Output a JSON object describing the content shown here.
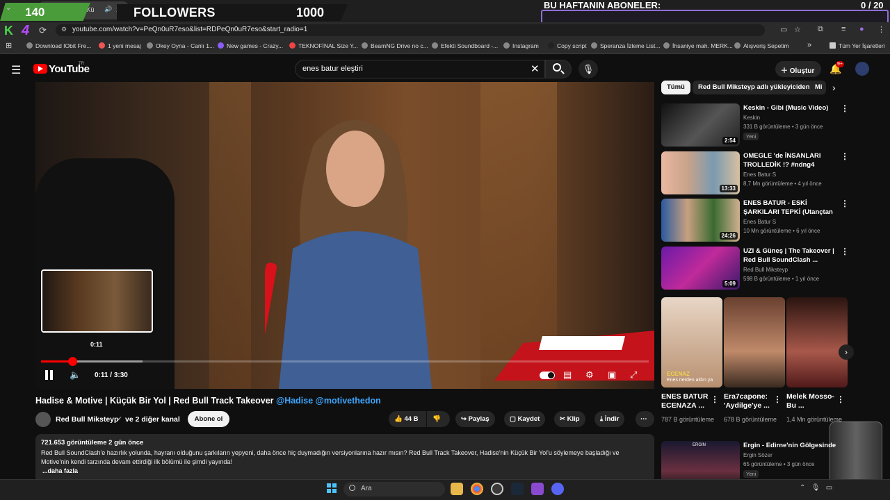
{
  "browser": {
    "tab_title": "dise & Motive | Kü",
    "url": "youtube.com/watch?v=PeQn0uR7eso&list=RDPeQn0uR7eso&start_radio=1",
    "bookmarks": [
      "Download IObit Fre...",
      "1 yeni mesaj",
      "Okey Oyna - Canlı 1...",
      "New games - Crazy...",
      "TEKNOFİNAL Size Y...",
      "BeamNG Drive no c...",
      "Efekti Soundboard -...",
      "Instagram",
      "Copy script",
      "Speranza İzleme List...",
      "İhsaniye mah. MERK...",
      "Alışveriş Sepetim"
    ],
    "bookmarks_more": "»",
    "all_bookmarks": "Tüm Yer İşaretleri"
  },
  "overlay": {
    "count": "140",
    "followers_label": "FOLLOWERS",
    "goal": "1000",
    "subs_title": "BU HAFTANIN ABONELER:",
    "subs_count": "0 / 20",
    "accent_green": "#4a9c3a",
    "accent_purple": "#8e6fd3"
  },
  "youtube": {
    "logo_text": "YouTube",
    "logo_region": "TR",
    "search_value": "enes batur eleştiri",
    "create_label": "Oluştur",
    "notif_badge": "9+",
    "brand_red": "#ff0000"
  },
  "player": {
    "preview_time": "0:11",
    "current_time": "0:11",
    "duration": "3:30",
    "progress_fraction": 0.052
  },
  "video": {
    "title": "Hadise & Motive | Küçük Bir Yol | Red Bull Track Takeover ",
    "title_tags": "@Hadise @motivethedon",
    "channel": "Red Bull Mikstеyp",
    "channel_extra": "ve 2 diğer kanal",
    "subscribe_label": "Abone ol",
    "likes": "44 B",
    "share_label": "Paylaş",
    "save_label": "Kaydet",
    "clip_label": "Klip",
    "download_label": "İndir",
    "views_line": "721.653 görüntüleme  2 gün önce",
    "description": "Red Bull SoundClash'e hazırlık yolunda, hayranı olduğunu şarkıların yepyeni, daha önce hiç duymadığın versiyonlarına hazır mısın? Red Bull Track Takeover, Hadise'nin Küçük Bir Yol'u söylemeye başladığı ve Motive'nin kendi tarzında devam ettirdiği ilk bölümü ile şimdi yayında!",
    "more_label": "...daha fazla"
  },
  "chips": [
    "Tümü",
    "Red Bull Mikstеyp adlı yükleyiciden",
    "Mi"
  ],
  "recommendations": [
    {
      "title": "Keskin - Gibi (Music Video)",
      "channel": "Keskin",
      "meta": "331 B görüntüleme • 3 gün önce",
      "badge": "Yeni",
      "duration": "2:54"
    },
    {
      "title": "OMEGLE 'de İNSANLARI TROLLEDİK !? #ndng4",
      "channel": "Enes Batur S",
      "meta": "8,7 Mn görüntüleme • 4 yıl önce",
      "badge": "",
      "duration": "13:33"
    },
    {
      "title": "ENES BATUR - ESKİ ŞARKILARI TEPKİ (Utançtan ağladım..)",
      "channel": "Enes Batur S",
      "meta": "10 Mn görüntüleme • 6 yıl önce",
      "badge": "",
      "duration": "24:26"
    },
    {
      "title": "UZI & Güneş | The Takeover | Red Bull SoundClash ...",
      "channel": "Red Bull Mikstеyp",
      "meta": "598 B görüntüleme • 1 yıl önce",
      "badge": "",
      "duration": "5:09"
    }
  ],
  "shorts": [
    {
      "title": "ENES BATUR ECENAZA ...",
      "views": "787 B görüntüleme",
      "caption": "ECENAZ",
      "subcaption": "Enes nerden aldın ya"
    },
    {
      "title": "Era7capone: 'Aydilge'ye ...",
      "views": "678 B görüntüleme"
    },
    {
      "title": "Melek Mosso-Bu ...",
      "views": "1,4 Mn görüntüleme"
    }
  ],
  "last_rec": {
    "title": "Ergin - Edirne'nin Gölgesinde",
    "channel": "Ergin Sözer",
    "meta": "65 görüntüleme • 3 gün önce",
    "badge": "Yeni",
    "thumb_label": "ERGİN"
  },
  "taskbar": {
    "search_label": "Ara"
  }
}
